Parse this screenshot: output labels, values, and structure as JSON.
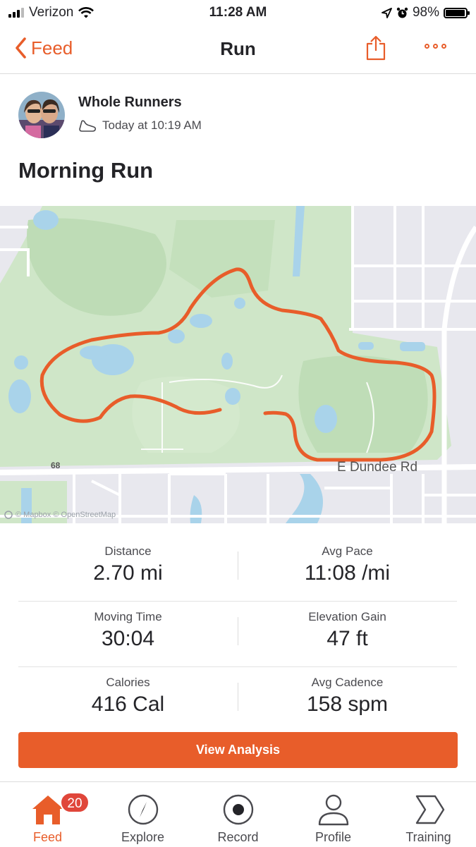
{
  "status_bar": {
    "carrier": "Verizon",
    "time": "11:28 AM",
    "battery": "98%",
    "battery_level": 0.98
  },
  "nav": {
    "back_label": "Feed",
    "title": "Run"
  },
  "activity": {
    "athlete_name": "Whole Runners",
    "timestamp": "Today at 10:19 AM",
    "title": "Morning Run"
  },
  "map": {
    "road_label": "E Dundee Rd",
    "route_number": "68",
    "attribution": "© Mapbox © OpenStreetMap"
  },
  "stats": [
    {
      "label": "Distance",
      "value": "2.70 mi"
    },
    {
      "label": "Avg Pace",
      "value": "11:08 /mi"
    },
    {
      "label": "Moving Time",
      "value": "30:04"
    },
    {
      "label": "Elevation Gain",
      "value": "47 ft"
    },
    {
      "label": "Calories",
      "value": "416 Cal"
    },
    {
      "label": "Avg Cadence",
      "value": "158 spm"
    }
  ],
  "analysis_button": "View Analysis",
  "tabs": [
    {
      "label": "Feed",
      "icon": "home-icon",
      "badge": "20",
      "active": true
    },
    {
      "label": "Explore",
      "icon": "compass-icon"
    },
    {
      "label": "Record",
      "icon": "record-icon"
    },
    {
      "label": "Profile",
      "icon": "profile-icon"
    },
    {
      "label": "Training",
      "icon": "training-icon"
    }
  ],
  "colors": {
    "accent": "#e85d2a",
    "badge": "#e0463a",
    "route": "#e85d2a",
    "park": "#cfe6c8",
    "water": "#a9d3ea"
  }
}
